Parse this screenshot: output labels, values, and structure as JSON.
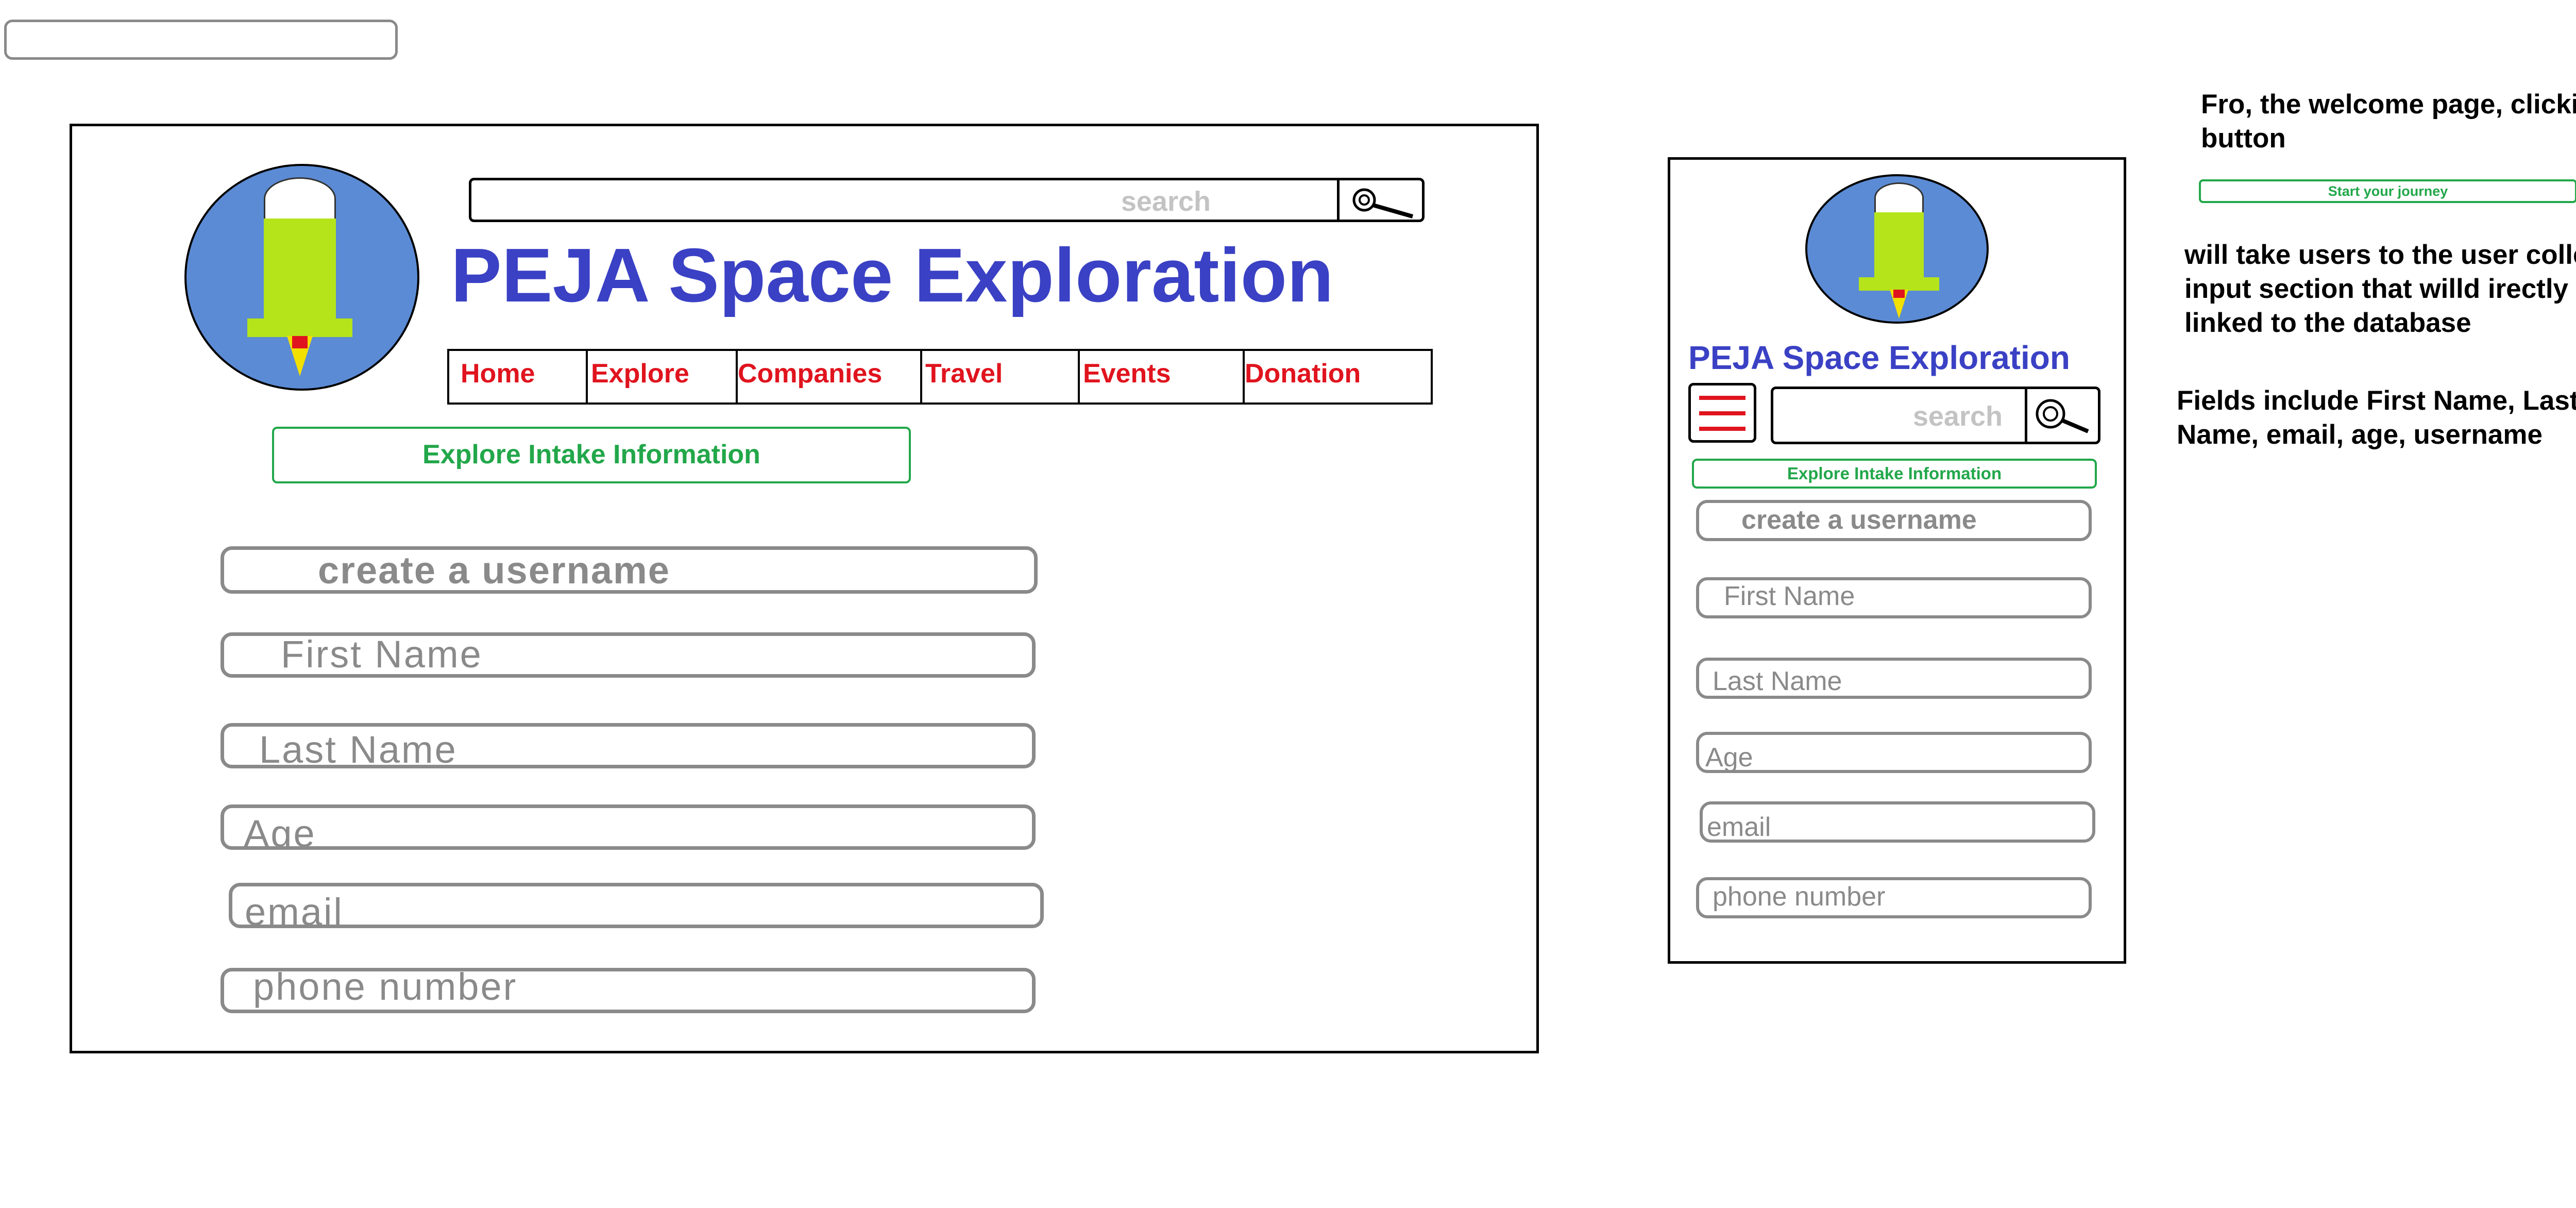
{
  "desktop": {
    "search": {
      "placeholder": "search"
    },
    "title": "PEJA Space Exploration",
    "nav": [
      "Home",
      "Explore",
      "Companies",
      "Travel",
      "Events",
      "Donation"
    ],
    "intake_button": "Explore Intake Information",
    "fields": [
      "create a username",
      "First Name",
      "Last Name",
      "Age",
      "email",
      "phone number"
    ]
  },
  "mobile": {
    "title": "PEJA Space Exploration",
    "search": {
      "placeholder": "search"
    },
    "intake_button": "Explore Intake Information",
    "fields": [
      "create a username",
      "First Name",
      "Last Name",
      "Age",
      "email",
      "phone number"
    ]
  },
  "notes": {
    "line1": "Fro, the welcome page, clicking this button",
    "start_button": "Start your journey",
    "line2": "will take users to the user collecfted input section that willd irectly be linked to the database",
    "line3": "Fields include First Name, Last Name, email, age, username"
  },
  "colors": {
    "title_blue": "#3a41c4",
    "nav_red": "#e0141e",
    "accent_green": "#22a74a",
    "field_gray": "#8a8a8a",
    "logo_blue": "#5b8bd4",
    "rocket_green": "#b5e41a"
  }
}
